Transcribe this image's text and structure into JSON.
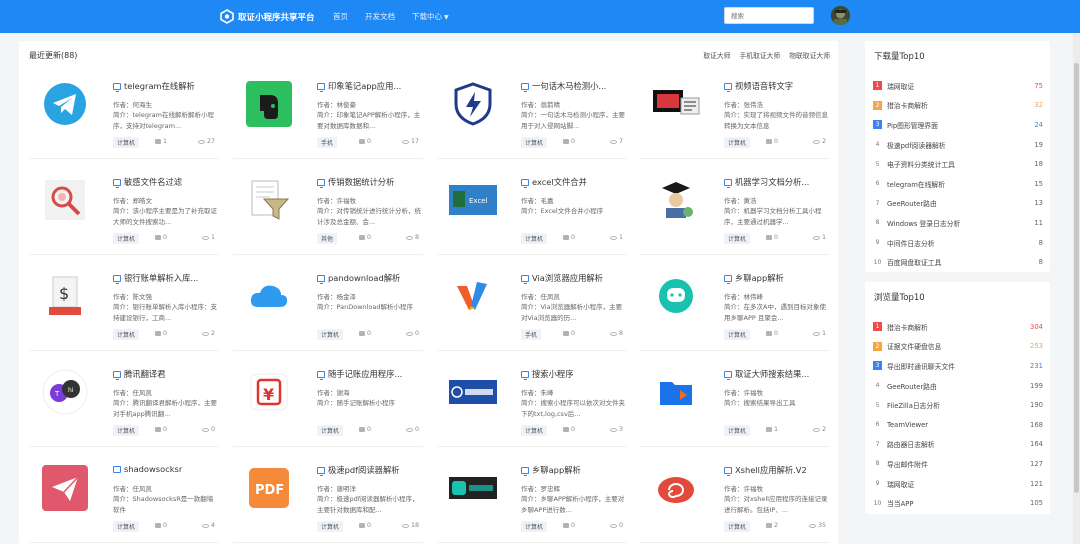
{
  "brand": {
    "title": "取证小程序共享平台",
    "logo_icon": "hexagon-logo-icon"
  },
  "nav": {
    "items": [
      "首页",
      "开发文档",
      "下载中心"
    ]
  },
  "search": {
    "placeholder": "搜索",
    "value": ""
  },
  "main": {
    "title": "最近更新(88)",
    "filters": [
      "取证大师",
      "手机取证大师",
      "物联取证大师"
    ]
  },
  "labels": {
    "author": "作者：",
    "desc": "简介："
  },
  "cards": [
    {
      "title": "telegram在线解析",
      "author": "何海生",
      "desc": "telegram在线解析解析小程序，支持对telegram...",
      "tag": "计算机",
      "likes": "1",
      "views": "27",
      "icon": "telegram-logo-icon"
    },
    {
      "title": "印象笔记app应用...",
      "author": "林俊豪",
      "desc": "印象笔记APP解析小程序，主要对数据库数据和...",
      "tag": "手机",
      "likes": "0",
      "views": "17",
      "icon": "evernote-logo-icon"
    },
    {
      "title": "一句话木马检测小...",
      "author": "翁箭晴",
      "desc": "一句话木马检测小程序，主要用于对入侵网站脚...",
      "tag": "计算机",
      "likes": "0",
      "views": "7",
      "icon": "shield-lightning-icon"
    },
    {
      "title": "视频语音转文字",
      "author": "张伟浩",
      "desc": "实现了将视频文件的音频信息转换为文本信息",
      "tag": "计算机",
      "likes": "0",
      "views": "2",
      "icon": "video-to-text-icon"
    },
    {
      "title": "敏感文件名过滤",
      "author": "郑皓文",
      "desc": "该小程序主要是为了补充取证大师的文件搜索功...",
      "tag": "计算机",
      "likes": "0",
      "views": "1",
      "icon": "magnifier-icon"
    },
    {
      "title": "传销数据统计分析",
      "author": "许福牧",
      "desc": "对传销统计进行统计分析，统计涉及总金额、会...",
      "tag": "其他",
      "likes": "0",
      "views": "8",
      "icon": "funnel-document-icon"
    },
    {
      "title": "excel文件合并",
      "author": "毛嘉",
      "desc": "Excel文件合并小程序",
      "tag": "计算机",
      "likes": "0",
      "views": "1",
      "icon": "excel-merge-icon"
    },
    {
      "title": "机器学习文档分析...",
      "author": "黄浩",
      "desc": "机器学习文档分析工具小程序，主要通过机器学...",
      "tag": "计算机",
      "likes": "0",
      "views": "1",
      "icon": "graduate-robot-icon"
    },
    {
      "title": "银行账单解析入库...",
      "author": "陈文强",
      "desc": "银行账单解析入库小程序：支持建设银行，工商...",
      "tag": "计算机",
      "likes": "0",
      "views": "2",
      "icon": "bill-dollar-icon"
    },
    {
      "title": "pandownload解析",
      "author": "杨金泽",
      "desc": "PanDownload解析小程序",
      "tag": "计算机",
      "likes": "0",
      "views": "0",
      "icon": "cloud-icon"
    },
    {
      "title": "Via浏览器应用解析",
      "author": "任凤凯",
      "desc": "Via浏览器解析小程序，主要对Via浏览器的历...",
      "tag": "手机",
      "likes": "0",
      "views": "8",
      "icon": "via-browser-icon"
    },
    {
      "title": "乡聊app解析",
      "author": "林伟峰",
      "desc": "在多次A中，遇到目标对象使用乡聊APP 且聚会...",
      "tag": "计算机",
      "likes": "0",
      "views": "1",
      "icon": "chat-face-icon"
    },
    {
      "title": "腾讯翻译君",
      "author": "任风凯",
      "desc": "腾讯翻译君解析小程序，主要对手机app腾讯翻...",
      "tag": "计算机",
      "likes": "0",
      "views": "0",
      "icon": "translate-bubbles-icon"
    },
    {
      "title": "随手记账应用程序...",
      "author": "谢海",
      "desc": "随手记账解析小程序",
      "tag": "计算机",
      "likes": "0",
      "views": "0",
      "icon": "yen-ledger-icon"
    },
    {
      "title": "搜索小程序",
      "author": "朱峰",
      "desc": "搜索小程序可以依次对文件夹下的txt,log,csv后...",
      "tag": "计算机",
      "likes": "0",
      "views": "3",
      "icon": "search-brand-icon"
    },
    {
      "title": "取证大师搜索结果...",
      "author": "许福牧",
      "desc": "搜索结果导出工具",
      "tag": "计算机",
      "likes": "1",
      "views": "2",
      "icon": "folder-export-icon"
    },
    {
      "title": "shadowsocksr",
      "author": "任风凯",
      "desc": "ShadowsocksR是一款翻墙软件",
      "tag": "计算机",
      "likes": "0",
      "views": "4",
      "icon": "paper-plane-icon"
    },
    {
      "title": "极速pdf阅读器解析",
      "author": "唐明洋",
      "desc": "极速pdf阅读器解析小程序，主要针对数据库和配...",
      "tag": "计算机",
      "likes": "0",
      "views": "18",
      "icon": "pdf-file-icon"
    },
    {
      "title": "乡聊app解析",
      "author": "罗忠辉",
      "desc": "乡聊APP解析小程序，主要对乡聊APP进行数...",
      "tag": "计算机",
      "likes": "0",
      "views": "0",
      "icon": "xiangliao-brand-icon"
    },
    {
      "title": "Xshell应用解析.V2",
      "author": "许福牧",
      "desc": "对xshell应用程序的连接记录进行解析。包括IP、...",
      "tag": "计算机",
      "likes": "2",
      "views": "35",
      "icon": "shell-spiral-icon"
    }
  ],
  "downloads": {
    "title": "下载量Top10",
    "items": [
      {
        "rank": "1",
        "name": "瑞网取证",
        "count": "75"
      },
      {
        "rank": "2",
        "name": "猎治卡商解析",
        "count": "32"
      },
      {
        "rank": "3",
        "name": "Pip图形管理界面",
        "count": "24"
      },
      {
        "rank": "4",
        "name": "极速pdf阅读器解析",
        "count": "19"
      },
      {
        "rank": "5",
        "name": "电子资料分类统计工具",
        "count": "18"
      },
      {
        "rank": "6",
        "name": "telegram在线解析",
        "count": "15"
      },
      {
        "rank": "7",
        "name": "GeeRouter路由",
        "count": "13"
      },
      {
        "rank": "8",
        "name": "Windows 登录日志分析",
        "count": "11"
      },
      {
        "rank": "9",
        "name": "中间件日志分析",
        "count": "8"
      },
      {
        "rank": "10",
        "name": "百度网盘取证工具",
        "count": "8"
      }
    ]
  },
  "views": {
    "title": "浏览量Top10",
    "items": [
      {
        "rank": "1",
        "name": "猎治卡商解析",
        "count": "304"
      },
      {
        "rank": "2",
        "name": "证据文件硬盘信息",
        "count": "253"
      },
      {
        "rank": "3",
        "name": "导出即时通讯聊天文件",
        "count": "231"
      },
      {
        "rank": "4",
        "name": "GeeRouter路由",
        "count": "199"
      },
      {
        "rank": "5",
        "name": "FileZilla日志分析",
        "count": "190"
      },
      {
        "rank": "6",
        "name": "TeamViewer",
        "count": "168"
      },
      {
        "rank": "7",
        "name": "路由器日志解析",
        "count": "164"
      },
      {
        "rank": "8",
        "name": "导出邮件附件",
        "count": "127"
      },
      {
        "rank": "9",
        "name": "瑞网取证",
        "count": "121"
      },
      {
        "rank": "10",
        "name": "当当APP",
        "count": "105"
      }
    ]
  },
  "colors": {
    "nav": "#1e88f5",
    "rank1": "#f04b4b",
    "rank2": "#f7a442",
    "rank3": "#3b82f6"
  }
}
